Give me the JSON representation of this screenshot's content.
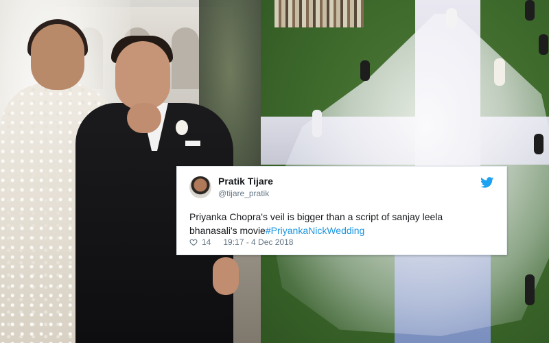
{
  "tweet": {
    "author_name": "Pratik Tijare",
    "author_handle": "@tijare_pratik",
    "text": "Priyanka Chopra's veil is bigger than a  script of sanjay leela bhanasali's movie",
    "hashtag": "#PriyankaNickWedding",
    "likes": "14",
    "timestamp": "19:17 - 4 Dec 2018"
  },
  "icons": {
    "platform": "twitter-bird-icon",
    "like": "heart-icon"
  },
  "colors": {
    "twitter_blue": "#1da1f2",
    "hashtag": "#1b95e0",
    "meta_gray": "#657786"
  }
}
